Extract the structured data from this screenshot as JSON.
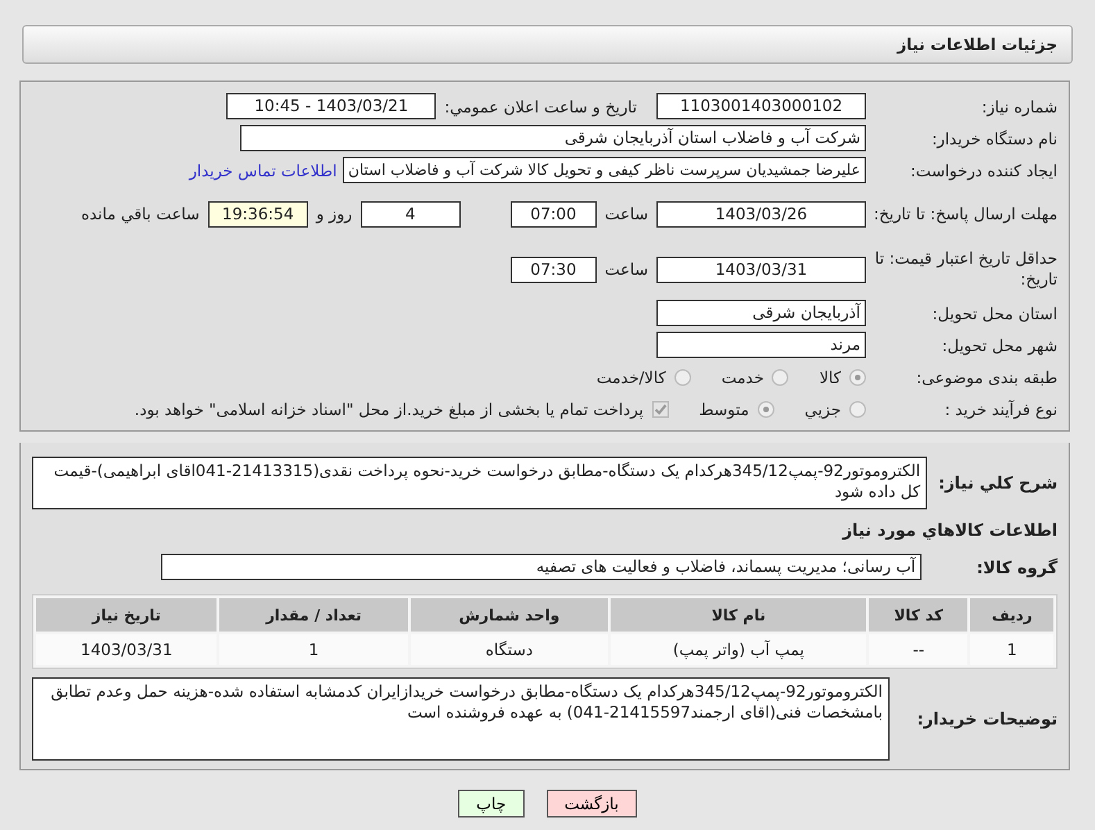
{
  "page": {
    "title": "جزئیات اطلاعات نیاز"
  },
  "need_number": {
    "label": "شماره نیاز:",
    "value": "1103001403000102"
  },
  "announce": {
    "label": "تاریخ و ساعت اعلان عمومي:",
    "value": "1403/03/21 - 10:45"
  },
  "buyer": {
    "label": "نام دستگاه خریدار:",
    "value": "شرکت آب و فاضلاب استان آذربایجان شرقی"
  },
  "creator": {
    "label": "ایجاد کننده درخواست:",
    "value": "علیرضا جمشیدیان سرپرست ناظر کیفی و تحویل کالا شرکت آب و فاضلاب استان",
    "link": "اطلاعات تماس خریدار"
  },
  "deadline": {
    "label": "مهلت ارسال پاسخ: تا تاریخ:",
    "date": "1403/03/26",
    "time_label": "ساعت",
    "time": "07:00",
    "days": "4",
    "days_label": "روز و",
    "remaining": "19:36:54",
    "remaining_label": "ساعت باقي مانده"
  },
  "validity": {
    "label": "حداقل تاریخ اعتبار قیمت: تا تاریخ:",
    "date": "1403/03/31",
    "time_label": "ساعت",
    "time": "07:30"
  },
  "province": {
    "label": "استان محل تحویل:",
    "value": "آذربایجان شرقی"
  },
  "city": {
    "label": "شهر محل تحویل:",
    "value": "مرند"
  },
  "category": {
    "label": "طبقه بندی موضوعی:",
    "options": [
      {
        "label": "کالا",
        "selected": true
      },
      {
        "label": "خدمت",
        "selected": false
      },
      {
        "label": "کالا/خدمت",
        "selected": false
      }
    ]
  },
  "purchase_type": {
    "label": "نوع فرآیند خرید :",
    "options": [
      {
        "label": "جزیي",
        "selected": false
      },
      {
        "label": "متوسط",
        "selected": true
      }
    ],
    "payment_checked": true,
    "payment_note": "پرداخت تمام یا بخشی از مبلغ خرید.از محل \"اسناد خزانه اسلامی\" خواهد بود."
  },
  "description": {
    "label": "شرح کلي نياز:",
    "text": "الکتروموتور92-پمپ345/12هرکدام یک دستگاه-مطابق درخواست خرید-نحوه پرداخت نقدی(21413315-041اقای ابراهیمی)-قیمت کل داده شود"
  },
  "goods": {
    "title": "اطلاعات کالاهاي مورد نياز",
    "group_label": "گروه کالا:",
    "group_value": "آب رسانی؛ مدیریت پسماند، فاضلاب و فعالیت های تصفیه",
    "columns": [
      "ردیف",
      "کد کالا",
      "نام کالا",
      "واحد شمارش",
      "تعداد / مقدار",
      "تاریخ نیاز"
    ],
    "rows": [
      [
        "1",
        "--",
        "پمپ آب (واتر پمپ)",
        "دستگاه",
        "1",
        "1403/03/31"
      ]
    ]
  },
  "notes": {
    "label": "توضیحات خریدار:",
    "text": "الکتروموتور92-پمپ345/12هرکدام یک دستگاه-مطابق درخواست خریدازایران کدمشابه استفاده شده-هزینه حمل وعدم تطابق بامشخصات فنی(اقای ارجمند21415597-041) به عهده فروشنده است"
  },
  "buttons": [
    {
      "label": "بازگشت",
      "kind": "back"
    },
    {
      "label": "چاپ",
      "kind": "print"
    }
  ]
}
